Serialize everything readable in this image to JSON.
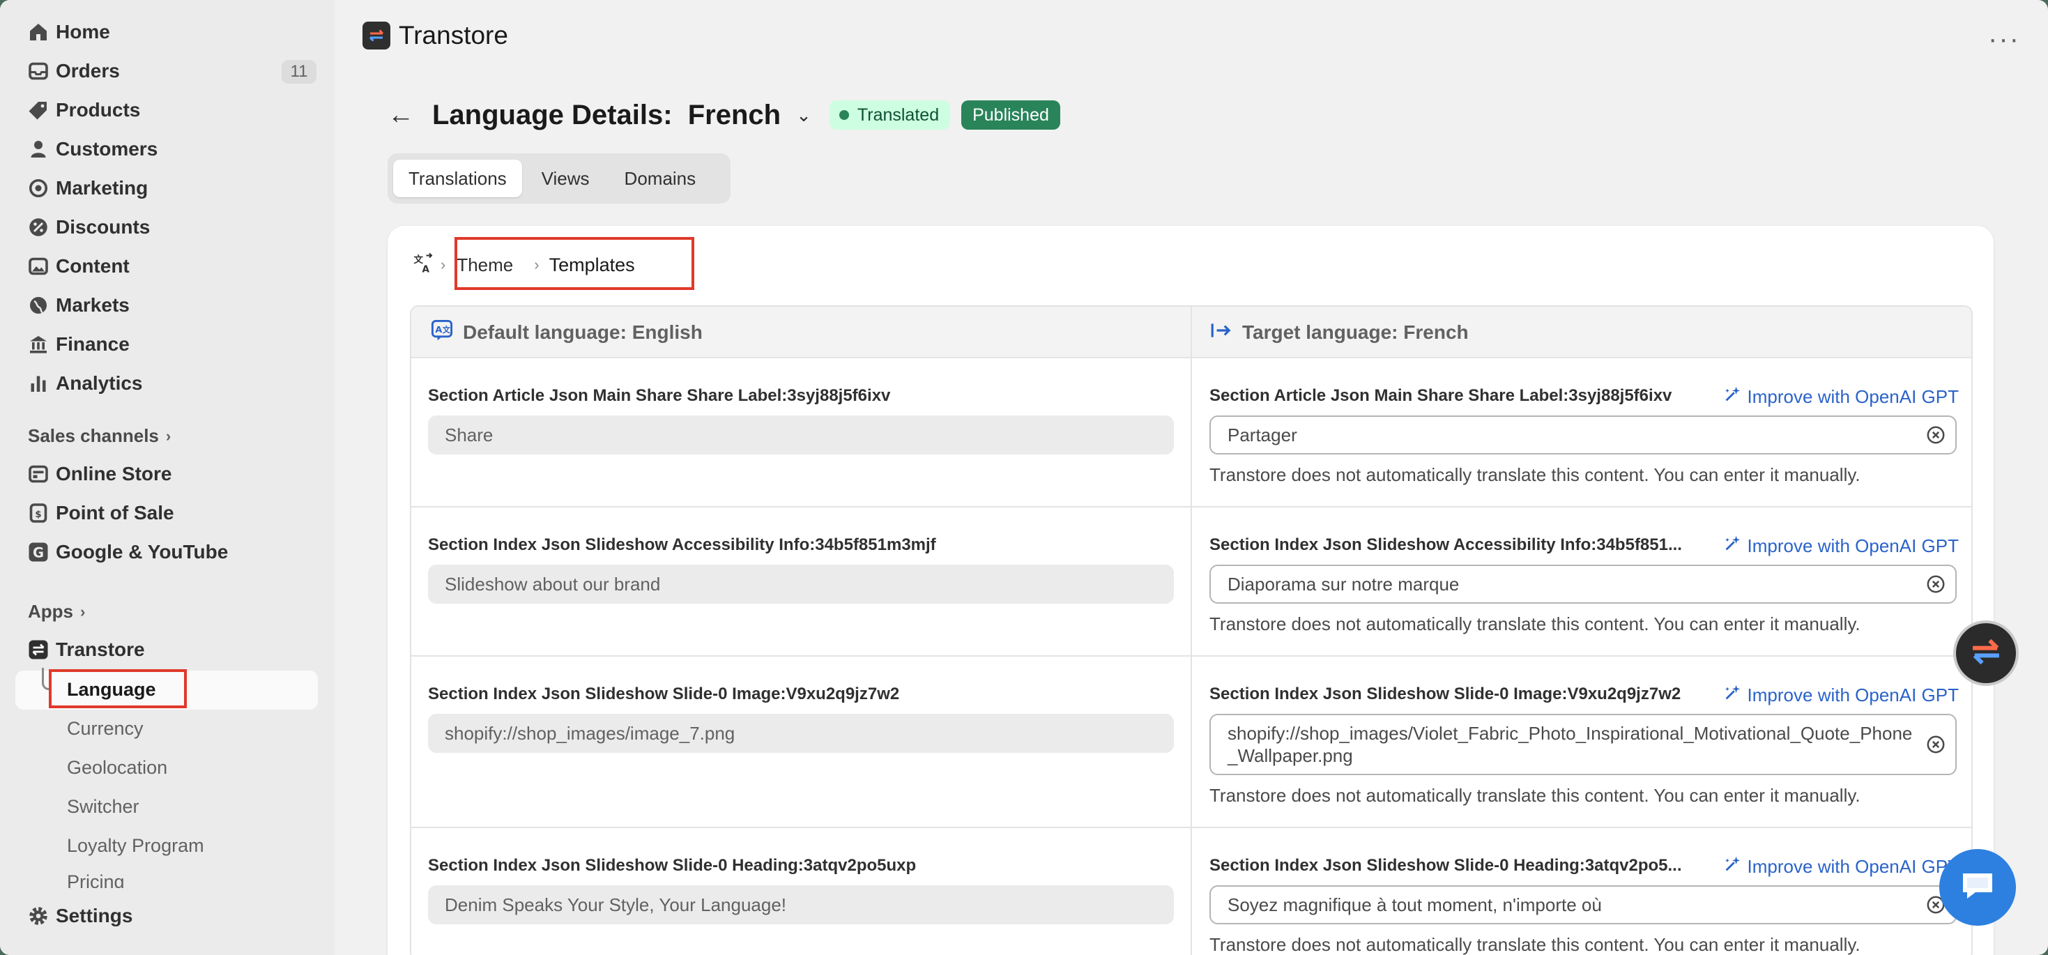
{
  "sidebar": {
    "nav": [
      {
        "label": "Home",
        "icon": "home-icon"
      },
      {
        "label": "Orders",
        "icon": "orders-icon",
        "count": "11"
      },
      {
        "label": "Products",
        "icon": "tag-icon"
      },
      {
        "label": "Customers",
        "icon": "person-icon"
      },
      {
        "label": "Marketing",
        "icon": "target-icon"
      },
      {
        "label": "Discounts",
        "icon": "discount-icon"
      },
      {
        "label": "Content",
        "icon": "image-icon"
      },
      {
        "label": "Markets",
        "icon": "globe-icon"
      },
      {
        "label": "Finance",
        "icon": "bank-icon"
      },
      {
        "label": "Analytics",
        "icon": "chart-icon"
      }
    ],
    "sales_channels_label": "Sales channels",
    "channels": [
      {
        "label": "Online Store",
        "icon": "store-icon"
      },
      {
        "label": "Point of Sale",
        "icon": "pos-icon"
      },
      {
        "label": "Google & YouTube",
        "icon": "google-icon"
      }
    ],
    "apps_label": "Apps",
    "app": {
      "label": "Transtore",
      "icon": "transtore-icon"
    },
    "app_sub": [
      "Language",
      "Currency",
      "Geolocation",
      "Switcher",
      "Loyalty Program",
      "Pricing"
    ],
    "settings_label": "Settings"
  },
  "header": {
    "app_title": "Transtore"
  },
  "page": {
    "title": "Language Details:  French",
    "badge_status": "Translated",
    "badge_publish": "Published",
    "tabs": [
      "Translations",
      "Views",
      "Domains"
    ],
    "breadcrumb": [
      "Theme",
      "Templates"
    ]
  },
  "table": {
    "default_header": "Default language: English",
    "target_header": "Target language: French",
    "improve_label": "Improve with OpenAI GPT",
    "note": "Transtore does not automatically translate this content. You can enter it manually.",
    "rows": [
      {
        "key": "Section Article Json Main Share Share Label:3syj88j5f6ixv",
        "target_key": "Section Article Json Main Share Share Label:3syj88j5f6ixv",
        "source": "Share",
        "target": "Partager"
      },
      {
        "key": "Section Index Json Slideshow Accessibility Info:34b5f851m3mjf",
        "target_key": "Section Index Json Slideshow Accessibility Info:34b5f851...",
        "source": "Slideshow about our brand",
        "target": "Diaporama sur notre marque"
      },
      {
        "key": "Section Index Json Slideshow Slide-0 Image:V9xu2q9jz7w2",
        "target_key": "Section Index Json Slideshow Slide-0 Image:V9xu2q9jz7w2",
        "source": "shopify://shop_images/image_7.png",
        "target": "shopify://shop_images/Violet_Fabric_Photo_Inspirational_Motivational_Quote_Phone_Wallpaper.png"
      },
      {
        "key": "Section Index Json Slideshow Slide-0 Heading:3atqv2po5uxp",
        "target_key": "Section Index Json Slideshow Slide-0 Heading:3atqv2po5...",
        "source": "Denim Speaks Your Style, Your Language!",
        "target": "Soyez magnifique à tout moment, n'importe où"
      }
    ]
  },
  "colors": {
    "accent_link": "#2a63c9",
    "highlight_box": "#e0392b",
    "published_badge": "#29845a",
    "translated_badge": "#cdfee1"
  }
}
